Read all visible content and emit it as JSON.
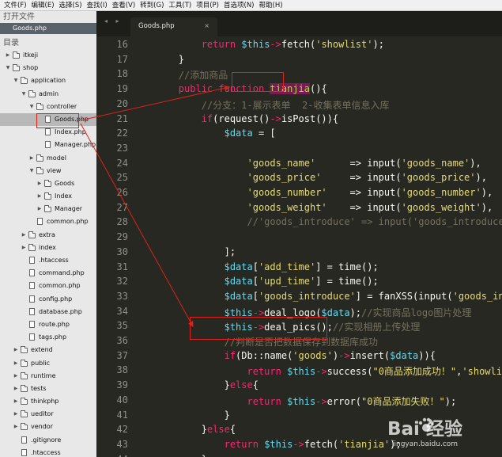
{
  "menu": [
    "文件(F)",
    "编辑(E)",
    "选择(S)",
    "查找(I)",
    "查看(V)",
    "转到(G)",
    "工具(T)",
    "项目(P)",
    "首选项(N)",
    "帮助(H)"
  ],
  "sidebar": {
    "open_files_header": "打开文件",
    "open_file": "Goods.php",
    "folders_header": "目录",
    "tree": [
      {
        "label": "itkeji",
        "type": "folder",
        "depth": 0,
        "open": false
      },
      {
        "label": "shop",
        "type": "folder",
        "depth": 0,
        "open": true
      },
      {
        "label": "application",
        "type": "folder",
        "depth": 1,
        "open": true
      },
      {
        "label": "admin",
        "type": "folder",
        "depth": 2,
        "open": true
      },
      {
        "label": "controller",
        "type": "folder",
        "depth": 3,
        "open": true
      },
      {
        "label": "Goods.php",
        "type": "file",
        "depth": 4,
        "selected": true
      },
      {
        "label": "Index.php",
        "type": "file",
        "depth": 4
      },
      {
        "label": "Manager.php",
        "type": "file",
        "depth": 4
      },
      {
        "label": "model",
        "type": "folder",
        "depth": 3,
        "open": false
      },
      {
        "label": "view",
        "type": "folder",
        "depth": 3,
        "open": true
      },
      {
        "label": "Goods",
        "type": "folder",
        "depth": 4,
        "open": false
      },
      {
        "label": "Index",
        "type": "folder",
        "depth": 4,
        "open": false
      },
      {
        "label": "Manager",
        "type": "folder",
        "depth": 4,
        "open": false
      },
      {
        "label": "common.php",
        "type": "file",
        "depth": 3
      },
      {
        "label": "extra",
        "type": "folder",
        "depth": 2,
        "open": false
      },
      {
        "label": "index",
        "type": "folder",
        "depth": 2,
        "open": false
      },
      {
        "label": ".htaccess",
        "type": "file",
        "depth": 2
      },
      {
        "label": "command.php",
        "type": "file",
        "depth": 2
      },
      {
        "label": "common.php",
        "type": "file",
        "depth": 2
      },
      {
        "label": "config.php",
        "type": "file",
        "depth": 2
      },
      {
        "label": "database.php",
        "type": "file",
        "depth": 2
      },
      {
        "label": "route.php",
        "type": "file",
        "depth": 2
      },
      {
        "label": "tags.php",
        "type": "file",
        "depth": 2
      },
      {
        "label": "extend",
        "type": "folder",
        "depth": 1,
        "open": false
      },
      {
        "label": "public",
        "type": "folder",
        "depth": 1,
        "open": false
      },
      {
        "label": "runtime",
        "type": "folder",
        "depth": 1,
        "open": false
      },
      {
        "label": "tests",
        "type": "folder",
        "depth": 1,
        "open": false
      },
      {
        "label": "thinkphp",
        "type": "folder",
        "depth": 1,
        "open": false
      },
      {
        "label": "ueditor",
        "type": "folder",
        "depth": 1,
        "open": false
      },
      {
        "label": "vendor",
        "type": "folder",
        "depth": 1,
        "open": false
      },
      {
        "label": ".gitignore",
        "type": "file",
        "depth": 1
      },
      {
        "label": ".htaccess",
        "type": "file",
        "depth": 1
      }
    ]
  },
  "editor": {
    "tab_nav": "◂ ▸",
    "tab_title": "Goods.php",
    "tab_close": "×",
    "lines": [
      {
        "num": "16",
        "tokens": [
          [
            "            ",
            "p"
          ],
          [
            "return",
            "kw"
          ],
          [
            " ",
            "p"
          ],
          [
            "$this",
            "var"
          ],
          [
            "->",
            "kw"
          ],
          [
            "fetch",
            "p"
          ],
          [
            "(",
            "p"
          ],
          [
            "'showlist'",
            "str"
          ],
          [
            ");",
            "p"
          ]
        ]
      },
      {
        "num": "17",
        "tokens": [
          [
            "        }",
            "p"
          ]
        ]
      },
      {
        "num": "18",
        "tokens": [
          [
            "        ",
            "p"
          ],
          [
            "//添加商品",
            "cm"
          ]
        ]
      },
      {
        "num": "19",
        "tokens": [
          [
            "        ",
            "p"
          ],
          [
            "public",
            "kw"
          ],
          [
            " ",
            "p"
          ],
          [
            "function",
            "kw"
          ],
          [
            " ",
            "p"
          ],
          [
            "tianjia",
            "fn"
          ],
          [
            "(){",
            "p"
          ]
        ]
      },
      {
        "num": "20",
        "tokens": [
          [
            "            ",
            "p"
          ],
          [
            "//分支：1-展示表单  2-收集表单信息入库",
            "cm"
          ]
        ]
      },
      {
        "num": "21",
        "tokens": [
          [
            "            ",
            "p"
          ],
          [
            "if",
            "kw"
          ],
          [
            "(request()",
            "p"
          ],
          [
            "->",
            "kw"
          ],
          [
            "isPost()){",
            "p"
          ]
        ]
      },
      {
        "num": "22",
        "tokens": [
          [
            "                ",
            "p"
          ],
          [
            "$data",
            "var"
          ],
          [
            " = [",
            "p"
          ]
        ]
      },
      {
        "num": "23",
        "tokens": [
          [
            "",
            "p"
          ]
        ]
      },
      {
        "num": "24",
        "tokens": [
          [
            "                    ",
            "p"
          ],
          [
            "'goods_name'",
            "str"
          ],
          [
            "      => input(",
            "p"
          ],
          [
            "'goods_name'",
            "str"
          ],
          [
            "),",
            "p"
          ]
        ]
      },
      {
        "num": "25",
        "tokens": [
          [
            "                    ",
            "p"
          ],
          [
            "'goods_price'",
            "str"
          ],
          [
            "     => input(",
            "p"
          ],
          [
            "'goods_price'",
            "str"
          ],
          [
            "),",
            "p"
          ]
        ]
      },
      {
        "num": "26",
        "tokens": [
          [
            "                    ",
            "p"
          ],
          [
            "'goods_number'",
            "str"
          ],
          [
            "    => input(",
            "p"
          ],
          [
            "'goods_number'",
            "str"
          ],
          [
            "),",
            "p"
          ]
        ]
      },
      {
        "num": "27",
        "tokens": [
          [
            "                    ",
            "p"
          ],
          [
            "'goods_weight'",
            "str"
          ],
          [
            "    => input(",
            "p"
          ],
          [
            "'goods_weight'",
            "str"
          ],
          [
            "),",
            "p"
          ]
        ]
      },
      {
        "num": "28",
        "tokens": [
          [
            "                    ",
            "p"
          ],
          [
            "//'goods_introduce' => input('goods_introduce')",
            "cm"
          ]
        ]
      },
      {
        "num": "29",
        "tokens": [
          [
            "",
            "p"
          ]
        ]
      },
      {
        "num": "30",
        "tokens": [
          [
            "                ];",
            "p"
          ]
        ]
      },
      {
        "num": "31",
        "tokens": [
          [
            "                ",
            "p"
          ],
          [
            "$data",
            "var"
          ],
          [
            "[",
            "p"
          ],
          [
            "'add_time'",
            "str"
          ],
          [
            "] = time();",
            "p"
          ]
        ]
      },
      {
        "num": "32",
        "tokens": [
          [
            "                ",
            "p"
          ],
          [
            "$data",
            "var"
          ],
          [
            "[",
            "p"
          ],
          [
            "'upd_time'",
            "str"
          ],
          [
            "] = time();",
            "p"
          ]
        ]
      },
      {
        "num": "33",
        "tokens": [
          [
            "                ",
            "p"
          ],
          [
            "$data",
            "var"
          ],
          [
            "[",
            "p"
          ],
          [
            "'goods_introduce'",
            "str"
          ],
          [
            "] = fanXSS(input(",
            "p"
          ],
          [
            "'goods_introduce'",
            "str"
          ],
          [
            "));",
            "p"
          ]
        ]
      },
      {
        "num": "34",
        "tokens": [
          [
            "                ",
            "p"
          ],
          [
            "$this",
            "var"
          ],
          [
            "->",
            "kw"
          ],
          [
            "deal_logo(",
            "p"
          ],
          [
            "$data",
            "var"
          ],
          [
            ");",
            "p"
          ],
          [
            "//实现商品logo图片处理",
            "cm"
          ]
        ]
      },
      {
        "num": "35",
        "tokens": [
          [
            "                ",
            "p"
          ],
          [
            "$this",
            "var"
          ],
          [
            "->",
            "kw"
          ],
          [
            "deal_pics();",
            "p"
          ],
          [
            "//实现相册上传处理",
            "cm"
          ]
        ]
      },
      {
        "num": "36",
        "tokens": [
          [
            "                ",
            "p"
          ],
          [
            "//判断是否把数据保存到数据库成功",
            "cm"
          ]
        ]
      },
      {
        "num": "37",
        "tokens": [
          [
            "                ",
            "p"
          ],
          [
            "if",
            "kw"
          ],
          [
            "(Db::name(",
            "p"
          ],
          [
            "'goods'",
            "str"
          ],
          [
            ")",
            "p"
          ],
          [
            "->",
            "kw"
          ],
          [
            "insert(",
            "p"
          ],
          [
            "$data",
            "var"
          ],
          [
            "))",
            "p"
          ],
          [
            "{",
            "p"
          ]
        ]
      },
      {
        "num": "38",
        "tokens": [
          [
            "                    ",
            "p"
          ],
          [
            "return",
            "kw"
          ],
          [
            " ",
            "p"
          ],
          [
            "$this",
            "var"
          ],
          [
            "->",
            "kw"
          ],
          [
            "success(",
            "p"
          ],
          [
            "\"0商品添加成功！\"",
            "str"
          ],
          [
            ",",
            "p"
          ],
          [
            "'showlist'",
            "str"
          ],
          [
            ");",
            "p"
          ]
        ]
      },
      {
        "num": "39",
        "tokens": [
          [
            "                ",
            "p"
          ],
          [
            "}",
            "p"
          ],
          [
            "else",
            "kw"
          ],
          [
            "{",
            "p"
          ]
        ]
      },
      {
        "num": "40",
        "tokens": [
          [
            "                    ",
            "p"
          ],
          [
            "return",
            "kw"
          ],
          [
            " ",
            "p"
          ],
          [
            "$this",
            "var"
          ],
          [
            "->",
            "kw"
          ],
          [
            "error(",
            "p"
          ],
          [
            "\"0商品添加失败！\"",
            "str"
          ],
          [
            ");",
            "p"
          ]
        ]
      },
      {
        "num": "41",
        "tokens": [
          [
            "                }",
            "p"
          ]
        ]
      },
      {
        "num": "42",
        "tokens": [
          [
            "            ",
            "p"
          ],
          [
            "}",
            "p"
          ],
          [
            "else",
            "kw"
          ],
          [
            "{",
            "p"
          ]
        ]
      },
      {
        "num": "43",
        "tokens": [
          [
            "                ",
            "p"
          ],
          [
            "return",
            "kw"
          ],
          [
            " ",
            "p"
          ],
          [
            "$this",
            "var"
          ],
          [
            "->",
            "kw"
          ],
          [
            "fetch(",
            "p"
          ],
          [
            "'tianjia'",
            "str"
          ],
          [
            ");",
            "p"
          ]
        ]
      },
      {
        "num": "44",
        "tokens": [
          [
            "            }",
            "p"
          ]
        ]
      }
    ]
  },
  "colors": {
    "keyword": "#f92672",
    "string": "#e6db74",
    "comment": "#75715e",
    "variable": "#66d9ef",
    "function_name": "#a6e22e",
    "plain": "#f8f8f2",
    "annotation_red": "#e0201a",
    "highlight_bg": "#7a1a55"
  },
  "watermark": {
    "brand": "Bai 经验",
    "url": "jingyan.baidu.com",
    "icon": "baidu-paw-icon"
  }
}
